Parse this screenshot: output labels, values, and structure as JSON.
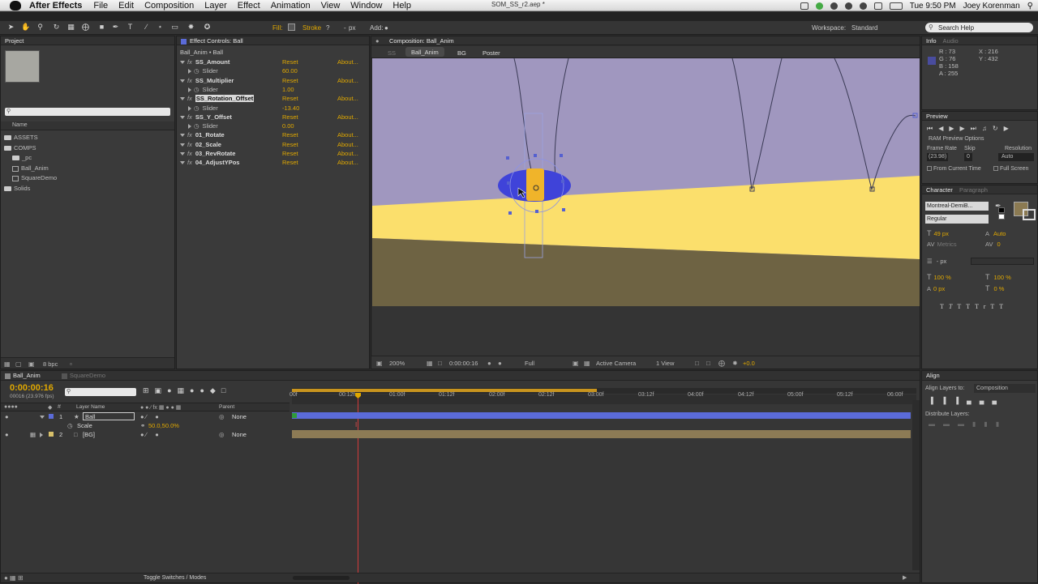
{
  "menubar": {
    "app_name": "After Effects",
    "items": [
      "File",
      "Edit",
      "Composition",
      "Layer",
      "Effect",
      "Animation",
      "View",
      "Window",
      "Help"
    ],
    "document_title": "SOM_SS_r2.aep *",
    "clock": "Tue 9:50 PM",
    "user": "Joey Korenman"
  },
  "toolbar": {
    "fill_label": "Fill:",
    "stroke_label": "Stroke",
    "stroke_value": "-",
    "px_label": "px",
    "add_label": "Add:",
    "workspace_label": "Workspace:",
    "workspace_value": "Standard",
    "search_placeholder": "Search Help"
  },
  "project_panel": {
    "title": "Project",
    "name_header": "Name",
    "items": [
      {
        "label": "ASSETS",
        "type": "folder",
        "indent": 0
      },
      {
        "label": "COMPS",
        "type": "folder",
        "indent": 0
      },
      {
        "label": "_pc",
        "type": "folder",
        "indent": 1
      },
      {
        "label": "Ball_Anim",
        "type": "comp",
        "indent": 1
      },
      {
        "label": "SquareDemo",
        "type": "comp",
        "indent": 1
      },
      {
        "label": "Solids",
        "type": "folder",
        "indent": 0
      }
    ],
    "bpc": "8 bpc"
  },
  "effect_controls": {
    "title": "Effect Controls: Ball",
    "subtitle": "Ball_Anim • Ball",
    "effects": [
      {
        "name": "SS_Amount",
        "reset": "Reset",
        "about": "About...",
        "slider_label": "Slider",
        "slider_value": "60.00"
      },
      {
        "name": "SS_Multiplier",
        "reset": "Reset",
        "about": "About...",
        "slider_label": "Slider",
        "slider_value": "1.00"
      },
      {
        "name": "SS_Rotation_Offset",
        "reset": "Reset",
        "about": "About...",
        "slider_label": "Slider",
        "slider_value": "-13.40"
      },
      {
        "name": "SS_Y_Offset",
        "reset": "Reset",
        "about": "About...",
        "slider_label": "Slider",
        "slider_value": "0.00"
      },
      {
        "name": "01_Rotate",
        "reset": "Reset",
        "about": "About..."
      },
      {
        "name": "02_Scale",
        "reset": "Reset",
        "about": "About..."
      },
      {
        "name": "03_RevRotate",
        "reset": "Reset",
        "about": "About..."
      },
      {
        "name": "04_AdjustYPos",
        "reset": "Reset",
        "about": "About..."
      }
    ]
  },
  "composition": {
    "title": "Composition: Ball_Anim",
    "breadcrumbs": [
      "SS",
      "Ball_Anim",
      "BG",
      "Poster"
    ],
    "zoom": "200%",
    "timecode": "0:00:00:16",
    "resolution": "Full",
    "camera": "Active Camera",
    "view": "1 View",
    "exposure": "+0.0"
  },
  "info_panel": {
    "title": "Info",
    "tab2": "Audio",
    "r": "R : 73",
    "g": "G : 76",
    "b": "B : 158",
    "a": "A : 255",
    "x": "X : 216",
    "y": "Y : 432",
    "swatch_color": "#494c9e"
  },
  "preview_panel": {
    "title": "Preview",
    "ram_options": "RAM Preview Options",
    "frame_rate_label": "Frame Rate",
    "skip_label": "Skip",
    "resolution_label": "Resolution",
    "frame_rate_value": "(23.98)",
    "skip_value": "0",
    "resolution_value": "Auto",
    "from_current": "From Current Time",
    "full_screen": "Full Screen"
  },
  "character_panel": {
    "title": "Character",
    "tab2": "Paragraph",
    "font": "Montreal-DemiB...",
    "style": "Regular",
    "size": "49 px",
    "leading": "Auto",
    "kerning": "Metrics",
    "tracking": "0",
    "stroke_width": "- px",
    "vert_scale": "100 %",
    "horiz_scale": "100 %",
    "baseline": "0 px",
    "tsume": "0 %",
    "fill_color": "#8b7a52"
  },
  "align_panel": {
    "title": "Align",
    "align_to_label": "Align Layers to:",
    "align_to_value": "Composition",
    "distribute_label": "Distribute Layers:"
  },
  "timeline": {
    "tabs": [
      "Ball_Anim",
      "SquareDemo"
    ],
    "timecode": "0:00:00:16",
    "fps": "00016 (23.976 fps)",
    "layer_name_header": "Layer Name",
    "parent_header": "Parent",
    "layers": [
      {
        "index": "1",
        "name": "Ball",
        "parent": "None",
        "color": "#5b6bd8"
      },
      {
        "index": "2",
        "name": "[BG]",
        "parent": "None",
        "color": "#d8c06a"
      }
    ],
    "scale_label": "Scale",
    "scale_value": "50.0,50.0%",
    "ruler": [
      "00f",
      "00:12f",
      "01:00f",
      "01:12f",
      "02:00f",
      "02:12f",
      "03:00f",
      "03:12f",
      "04:00f",
      "04:12f",
      "05:00f",
      "05:12f",
      "06:00f"
    ],
    "toggle_label": "Toggle Switches / Modes"
  }
}
